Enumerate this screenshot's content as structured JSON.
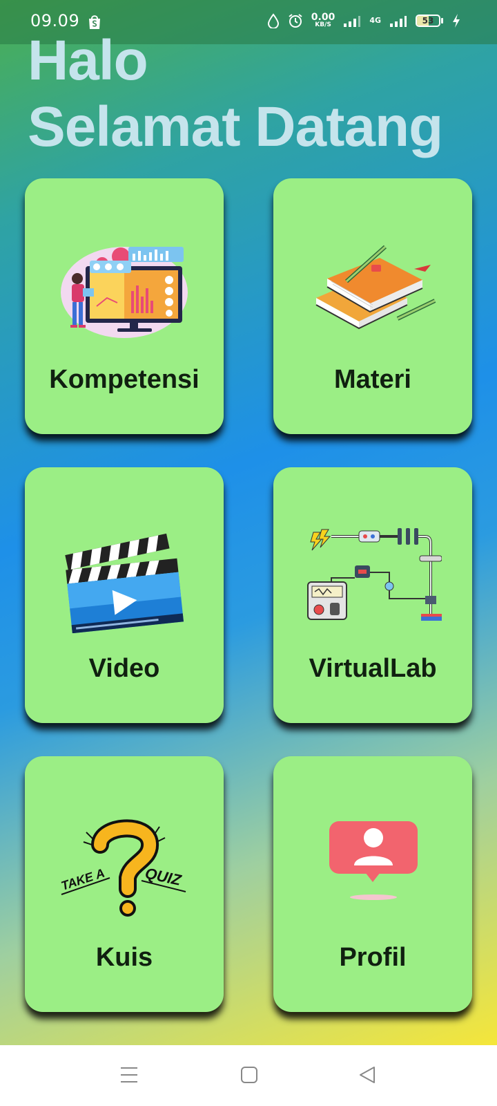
{
  "status_bar": {
    "time": "09.09",
    "net_speed_value": "0.00",
    "net_speed_unit": "KB/S",
    "network_type": "4G",
    "battery_level": "53",
    "icons": [
      "shopee-bag-icon",
      "water-drop-icon",
      "alarm-icon",
      "signal-icon",
      "charging-icon"
    ]
  },
  "greeting": {
    "line1": "Halo",
    "line2": "Selamat Datang"
  },
  "menu": [
    {
      "label": "Kompetensi",
      "icon": "competency-illustration"
    },
    {
      "label": "Materi",
      "icon": "books-illustration"
    },
    {
      "label": "Video",
      "icon": "clapperboard-illustration"
    },
    {
      "label": "VirtualLab",
      "icon": "circuit-illustration"
    },
    {
      "label": "Kuis",
      "icon": "quiz-illustration"
    },
    {
      "label": "Profil",
      "icon": "profile-illustration"
    }
  ],
  "quiz_art_text": {
    "left": "TAKE A",
    "right": "QUIZ"
  },
  "colors": {
    "card": "#9bee85",
    "greeting_text": "#c5e4ec",
    "label_text": "#102010",
    "profile_accent": "#f2646e"
  },
  "nav_bar": [
    "menu-nav-icon",
    "home-nav-icon",
    "back-nav-icon"
  ]
}
